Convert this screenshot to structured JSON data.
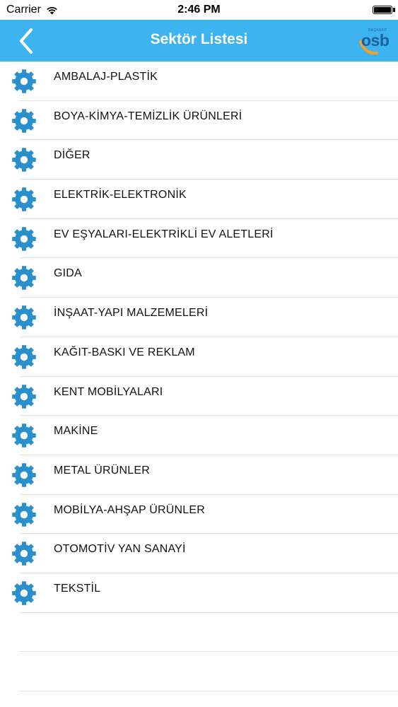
{
  "status_bar": {
    "carrier": "Carrier",
    "time": "2:46 PM",
    "wifi_icon": "wifi-icon",
    "battery_icon": "battery-icon"
  },
  "nav_bar": {
    "title": "Sektör Listesi",
    "back_icon": "chevron-left-icon",
    "logo_text": "osb",
    "logo_small_text": "BAŞKENT",
    "background_color": "#3db4ef"
  },
  "sector_list": {
    "icon_name": "gear-icon",
    "icon_color": "#2a8fcd",
    "items": [
      {
        "label": "AMBALAJ-PLASTİK"
      },
      {
        "label": "BOYA-KİMYA-TEMİZLİK ÜRÜNLERİ"
      },
      {
        "label": "DİĞER"
      },
      {
        "label": "ELEKTRİK-ELEKTRONİK"
      },
      {
        "label": "EV EŞYALARI-ELEKTRİKLİ EV ALETLERİ"
      },
      {
        "label": "GIDA"
      },
      {
        "label": "İNŞAAT-YAPI MALZEMELERİ"
      },
      {
        "label": "KAĞIT-BASKI VE REKLAM"
      },
      {
        "label": "KENT MOBİLYALARI"
      },
      {
        "label": "MAKİNE"
      },
      {
        "label": "METAL ÜRÜNLER"
      },
      {
        "label": "MOBİLYA-AHŞAP ÜRÜNLER"
      },
      {
        "label": "OTOMOTİV YAN SANAYİ"
      },
      {
        "label": "TEKSTİL"
      }
    ]
  }
}
